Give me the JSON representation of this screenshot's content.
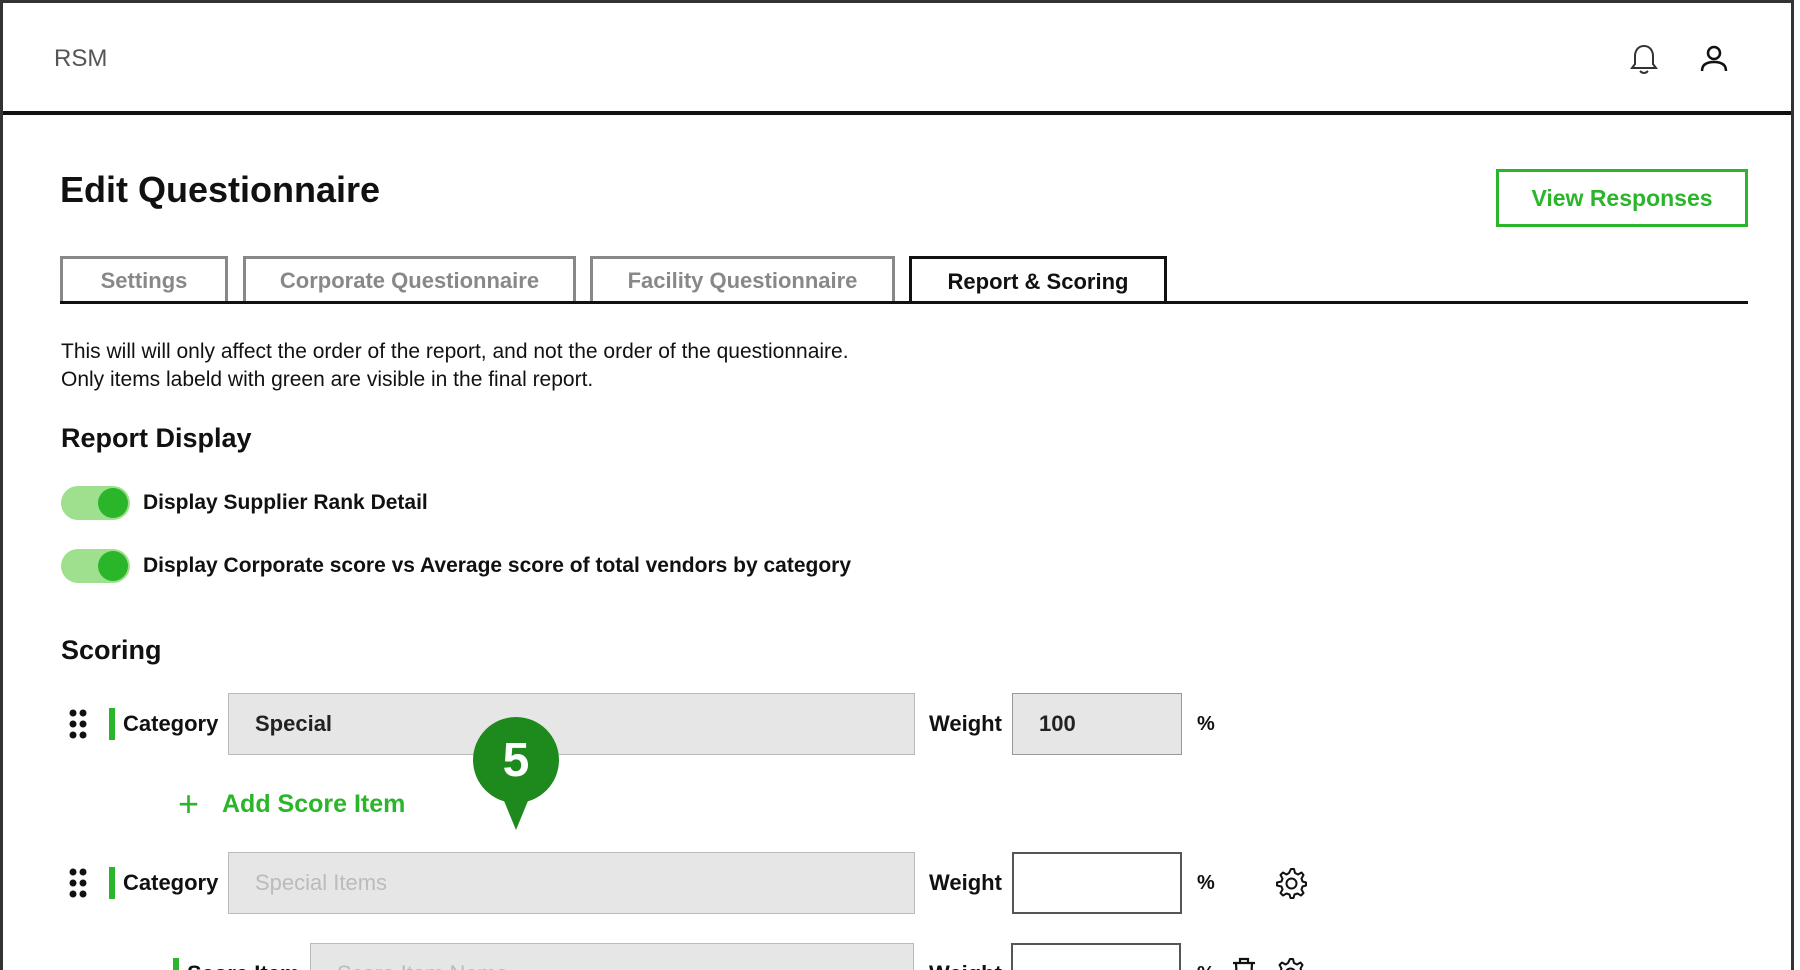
{
  "app": {
    "brand": "RSM"
  },
  "header": {
    "title": "Edit Questionnaire",
    "view_responses": "View Responses"
  },
  "tabs": [
    {
      "label": "Settings",
      "active": false
    },
    {
      "label": "Corporate Questionnaire",
      "active": false
    },
    {
      "label": "Facility Questionnaire",
      "active": false
    },
    {
      "label": "Report & Scoring",
      "active": true
    }
  ],
  "description": {
    "line1": "This will will only affect the order of the report, and not the order of the questionnaire.",
    "line2": "Only items labeld with green are visible in the final report."
  },
  "report_display": {
    "title": "Report Display",
    "toggles": [
      {
        "label": "Display Supplier Rank Detail",
        "on": true
      },
      {
        "label": "Display Corporate score vs Average score of total vendors by category",
        "on": true
      }
    ]
  },
  "scoring": {
    "title": "Scoring",
    "rows": [
      {
        "label": "Category",
        "value": "Special",
        "weight_label": "Weight",
        "weight_value": "100",
        "unit": "%"
      },
      {
        "label": "Category",
        "placeholder": "Special Items",
        "weight_label": "Weight",
        "weight_value": "",
        "unit": "%"
      },
      {
        "label": "Score Item",
        "placeholder": "Score Item Name",
        "weight_label": "Weight",
        "weight_value": "",
        "unit": "%"
      }
    ],
    "add_score_item": "Add Score Item"
  },
  "annotation": {
    "step": "5"
  },
  "colors": {
    "accent": "#2ab52a",
    "toggle_track": "#9ee08e",
    "marker": "#1e8a1e"
  },
  "icons": [
    "bell-icon",
    "user-icon",
    "drag-handle-icon",
    "plus-icon",
    "gear-icon",
    "trash-icon"
  ]
}
